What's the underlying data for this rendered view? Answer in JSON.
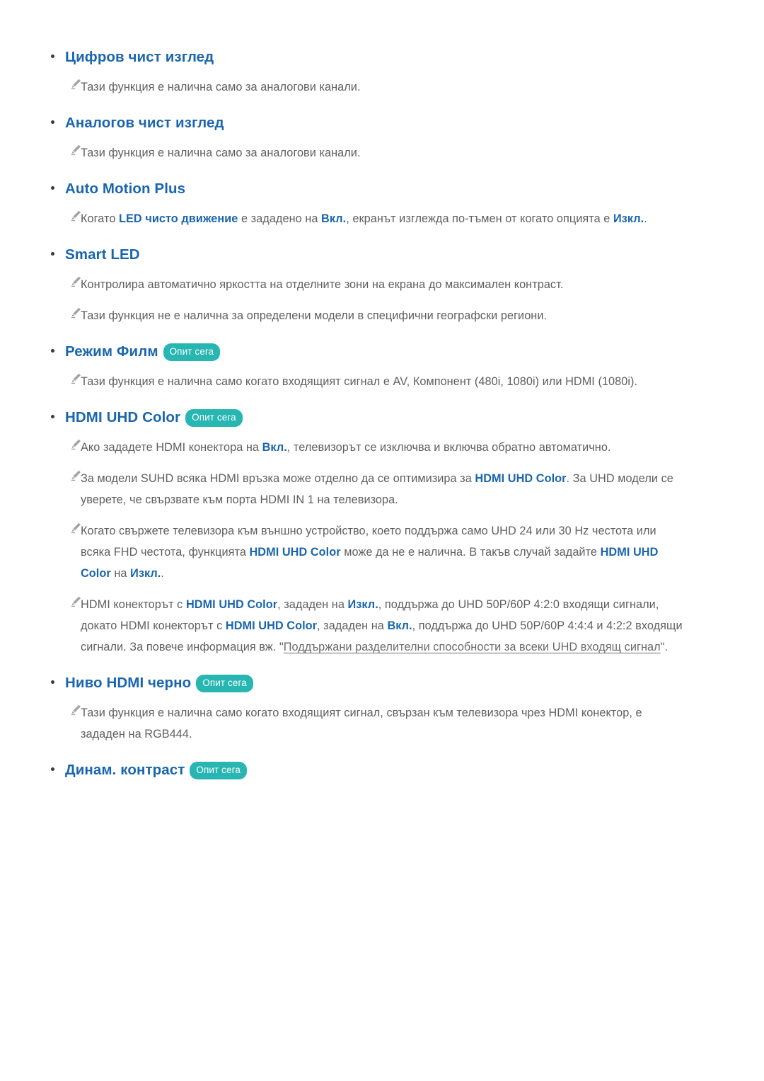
{
  "page": {
    "background": "#ffffff",
    "heading_color": "#1a66ae",
    "body_color": "#5f5f5f",
    "badge_color": "#27b6b2",
    "badge_text_color": "#ffffff",
    "bullet_color": "#3a3a3a"
  },
  "badge_label": "Опит сега",
  "sections": [
    {
      "id": "digital-clean-view",
      "title": "Цифров чист изглед",
      "badge": false,
      "notes": [
        {
          "id": "note-digital-clean-view-1",
          "parts": [
            {
              "t": "Тази функция е налична само за аналогови канали.",
              "s": "n"
            }
          ]
        }
      ]
    },
    {
      "id": "analog-clean-view",
      "title": "Аналогов чист изглед",
      "badge": false,
      "notes": [
        {
          "id": "note-analog-clean-view-1",
          "parts": [
            {
              "t": "Тази функция е налична само за аналогови канали.",
              "s": "n"
            }
          ]
        }
      ]
    },
    {
      "id": "auto-motion-plus",
      "title": "Auto Motion Plus",
      "badge": false,
      "notes": [
        {
          "id": "note-auto-motion-plus-1",
          "parts": [
            {
              "t": "Когато ",
              "s": "n"
            },
            {
              "t": "LED чисто движение",
              "s": "b"
            },
            {
              "t": " е зададено на ",
              "s": "n"
            },
            {
              "t": "Вкл.",
              "s": "b"
            },
            {
              "t": ", екранът изглежда по-тъмен от когато опцията е ",
              "s": "n"
            },
            {
              "t": "Изкл.",
              "s": "b"
            },
            {
              "t": ".",
              "s": "n"
            }
          ]
        }
      ]
    },
    {
      "id": "smart-led",
      "title": "Smart LED",
      "badge": false,
      "notes": [
        {
          "id": "note-smart-led-1",
          "parts": [
            {
              "t": "Контролира автоматично яркостта на отделните зони на екрана до максимален контраст.",
              "s": "n"
            }
          ]
        },
        {
          "id": "note-smart-led-2",
          "parts": [
            {
              "t": "Тази функция не е налична за определени модели в специфични географски региони.",
              "s": "n"
            }
          ]
        }
      ]
    },
    {
      "id": "film-mode",
      "title": "Режим Филм",
      "badge": true,
      "notes": [
        {
          "id": "note-film-mode-1",
          "parts": [
            {
              "t": "Тази функция е налична само когато входящият сигнал е AV, Компонент (480i, 1080i) или HDMI (1080i).",
              "s": "n"
            }
          ]
        }
      ]
    },
    {
      "id": "hdmi-uhd-color",
      "title": "HDMI UHD Color",
      "badge": true,
      "notes": [
        {
          "id": "note-hdmi-uhd-color-1",
          "parts": [
            {
              "t": "Ако зададете HDMI конектора на ",
              "s": "n"
            },
            {
              "t": "Вкл.",
              "s": "b"
            },
            {
              "t": ", телевизорът се изключва и включва обратно автоматично.",
              "s": "n"
            }
          ]
        },
        {
          "id": "note-hdmi-uhd-color-2",
          "parts": [
            {
              "t": "За модели SUHD всяка HDMI връзка може отделно да се оптимизира за ",
              "s": "n"
            },
            {
              "t": "HDMI UHD Color",
              "s": "b"
            },
            {
              "t": ". За UHD модели се уверете, че свързвате към порта HDMI IN 1 на телевизора.",
              "s": "n"
            }
          ]
        },
        {
          "id": "note-hdmi-uhd-color-3",
          "parts": [
            {
              "t": "Когато свържете телевизора към външно устройство, което поддържа само UHD 24 или 30 Hz честота или всяка FHD честота, функцията ",
              "s": "n"
            },
            {
              "t": "HDMI UHD Color",
              "s": "b"
            },
            {
              "t": " може да не е налична. В такъв случай задайте ",
              "s": "n"
            },
            {
              "t": "HDMI UHD Color",
              "s": "b"
            },
            {
              "t": " на ",
              "s": "n"
            },
            {
              "t": "Изкл.",
              "s": "b"
            },
            {
              "t": ".",
              "s": "n"
            }
          ]
        },
        {
          "id": "note-hdmi-uhd-color-4",
          "parts": [
            {
              "t": "HDMI конекторът с ",
              "s": "n"
            },
            {
              "t": "HDMI UHD Color",
              "s": "b"
            },
            {
              "t": ", зададен на ",
              "s": "n"
            },
            {
              "t": "Изкл.",
              "s": "b"
            },
            {
              "t": ", поддържа до UHD 50P/60P 4:2:0 входящи сигнали, докато HDMI конекторът с ",
              "s": "n"
            },
            {
              "t": "HDMI UHD Color",
              "s": "b"
            },
            {
              "t": ", зададен на ",
              "s": "n"
            },
            {
              "t": "Вкл.",
              "s": "b"
            },
            {
              "t": ", поддържа до UHD 50P/60P 4:4:4 и 4:2:2 входящи сигнали. За повече информация вж. \"",
              "s": "n"
            },
            {
              "t": "Поддържани разделителни способности за всеки UHD входящ сигнал",
              "s": "l"
            },
            {
              "t": "\".",
              "s": "n"
            }
          ]
        }
      ]
    },
    {
      "id": "hdmi-black-level",
      "title": "Ниво HDMI черно",
      "badge": true,
      "notes": [
        {
          "id": "note-hdmi-black-level-1",
          "parts": [
            {
              "t": "Тази функция е налична само когато входящият сигнал, свързан към телевизора чрез HDMI конектор, е зададен на RGB444.",
              "s": "n"
            }
          ]
        }
      ]
    },
    {
      "id": "dynamic-contrast",
      "title": "Динам. контраст",
      "badge": true,
      "notes": []
    }
  ]
}
